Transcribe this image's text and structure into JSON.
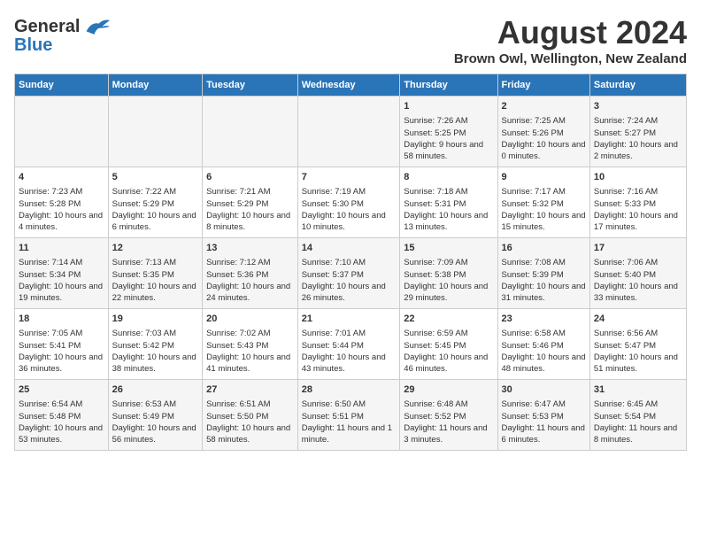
{
  "header": {
    "logo_general": "General",
    "logo_blue": "Blue",
    "title": "August 2024",
    "subtitle": "Brown Owl, Wellington, New Zealand"
  },
  "columns": [
    "Sunday",
    "Monday",
    "Tuesday",
    "Wednesday",
    "Thursday",
    "Friday",
    "Saturday"
  ],
  "weeks": [
    [
      {
        "day": "",
        "info": ""
      },
      {
        "day": "",
        "info": ""
      },
      {
        "day": "",
        "info": ""
      },
      {
        "day": "",
        "info": ""
      },
      {
        "day": "1",
        "info": "Sunrise: 7:26 AM\nSunset: 5:25 PM\nDaylight: 9 hours and 58 minutes."
      },
      {
        "day": "2",
        "info": "Sunrise: 7:25 AM\nSunset: 5:26 PM\nDaylight: 10 hours and 0 minutes."
      },
      {
        "day": "3",
        "info": "Sunrise: 7:24 AM\nSunset: 5:27 PM\nDaylight: 10 hours and 2 minutes."
      }
    ],
    [
      {
        "day": "4",
        "info": "Sunrise: 7:23 AM\nSunset: 5:28 PM\nDaylight: 10 hours and 4 minutes."
      },
      {
        "day": "5",
        "info": "Sunrise: 7:22 AM\nSunset: 5:29 PM\nDaylight: 10 hours and 6 minutes."
      },
      {
        "day": "6",
        "info": "Sunrise: 7:21 AM\nSunset: 5:29 PM\nDaylight: 10 hours and 8 minutes."
      },
      {
        "day": "7",
        "info": "Sunrise: 7:19 AM\nSunset: 5:30 PM\nDaylight: 10 hours and 10 minutes."
      },
      {
        "day": "8",
        "info": "Sunrise: 7:18 AM\nSunset: 5:31 PM\nDaylight: 10 hours and 13 minutes."
      },
      {
        "day": "9",
        "info": "Sunrise: 7:17 AM\nSunset: 5:32 PM\nDaylight: 10 hours and 15 minutes."
      },
      {
        "day": "10",
        "info": "Sunrise: 7:16 AM\nSunset: 5:33 PM\nDaylight: 10 hours and 17 minutes."
      }
    ],
    [
      {
        "day": "11",
        "info": "Sunrise: 7:14 AM\nSunset: 5:34 PM\nDaylight: 10 hours and 19 minutes."
      },
      {
        "day": "12",
        "info": "Sunrise: 7:13 AM\nSunset: 5:35 PM\nDaylight: 10 hours and 22 minutes."
      },
      {
        "day": "13",
        "info": "Sunrise: 7:12 AM\nSunset: 5:36 PM\nDaylight: 10 hours and 24 minutes."
      },
      {
        "day": "14",
        "info": "Sunrise: 7:10 AM\nSunset: 5:37 PM\nDaylight: 10 hours and 26 minutes."
      },
      {
        "day": "15",
        "info": "Sunrise: 7:09 AM\nSunset: 5:38 PM\nDaylight: 10 hours and 29 minutes."
      },
      {
        "day": "16",
        "info": "Sunrise: 7:08 AM\nSunset: 5:39 PM\nDaylight: 10 hours and 31 minutes."
      },
      {
        "day": "17",
        "info": "Sunrise: 7:06 AM\nSunset: 5:40 PM\nDaylight: 10 hours and 33 minutes."
      }
    ],
    [
      {
        "day": "18",
        "info": "Sunrise: 7:05 AM\nSunset: 5:41 PM\nDaylight: 10 hours and 36 minutes."
      },
      {
        "day": "19",
        "info": "Sunrise: 7:03 AM\nSunset: 5:42 PM\nDaylight: 10 hours and 38 minutes."
      },
      {
        "day": "20",
        "info": "Sunrise: 7:02 AM\nSunset: 5:43 PM\nDaylight: 10 hours and 41 minutes."
      },
      {
        "day": "21",
        "info": "Sunrise: 7:01 AM\nSunset: 5:44 PM\nDaylight: 10 hours and 43 minutes."
      },
      {
        "day": "22",
        "info": "Sunrise: 6:59 AM\nSunset: 5:45 PM\nDaylight: 10 hours and 46 minutes."
      },
      {
        "day": "23",
        "info": "Sunrise: 6:58 AM\nSunset: 5:46 PM\nDaylight: 10 hours and 48 minutes."
      },
      {
        "day": "24",
        "info": "Sunrise: 6:56 AM\nSunset: 5:47 PM\nDaylight: 10 hours and 51 minutes."
      }
    ],
    [
      {
        "day": "25",
        "info": "Sunrise: 6:54 AM\nSunset: 5:48 PM\nDaylight: 10 hours and 53 minutes."
      },
      {
        "day": "26",
        "info": "Sunrise: 6:53 AM\nSunset: 5:49 PM\nDaylight: 10 hours and 56 minutes."
      },
      {
        "day": "27",
        "info": "Sunrise: 6:51 AM\nSunset: 5:50 PM\nDaylight: 10 hours and 58 minutes."
      },
      {
        "day": "28",
        "info": "Sunrise: 6:50 AM\nSunset: 5:51 PM\nDaylight: 11 hours and 1 minute."
      },
      {
        "day": "29",
        "info": "Sunrise: 6:48 AM\nSunset: 5:52 PM\nDaylight: 11 hours and 3 minutes."
      },
      {
        "day": "30",
        "info": "Sunrise: 6:47 AM\nSunset: 5:53 PM\nDaylight: 11 hours and 6 minutes."
      },
      {
        "day": "31",
        "info": "Sunrise: 6:45 AM\nSunset: 5:54 PM\nDaylight: 11 hours and 8 minutes."
      }
    ]
  ]
}
